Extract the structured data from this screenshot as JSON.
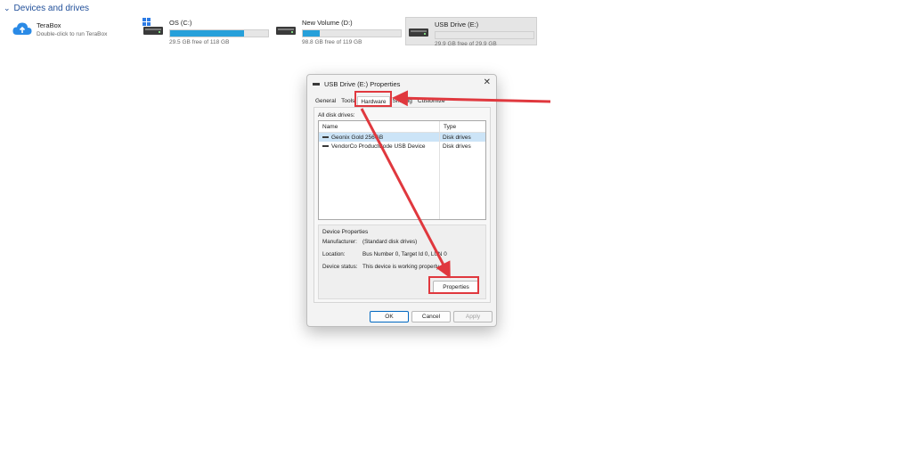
{
  "explorer": {
    "section_title": "Devices and drives",
    "terabox": {
      "name": "TeraBox",
      "subtitle": "Double-click to run TeraBox"
    },
    "drives": [
      {
        "name": "OS (C:)",
        "free_text": "29.5 GB free of 118 GB",
        "used_fraction": 0.75
      },
      {
        "name": "New Volume (D:)",
        "free_text": "98.8 GB free of 119 GB",
        "used_fraction": 0.17
      },
      {
        "name": "USB Drive (E:)",
        "free_text": "29.9 GB free of 29.9 GB",
        "used_fraction": 0.0
      }
    ]
  },
  "dialog": {
    "title": "USB Drive (E:) Properties",
    "close_glyph": "✕",
    "tabs": [
      "General",
      "Tools",
      "Hardware",
      "Sharing",
      "Customize"
    ],
    "active_tab": "Hardware",
    "all_disk_label": "All disk drives:",
    "columns": {
      "name": "Name",
      "type": "Type"
    },
    "rows": [
      {
        "name": "Geonix Gold 256GB",
        "type": "Disk drives"
      },
      {
        "name": "VendorCo ProductCode USB Device",
        "type": "Disk drives"
      }
    ],
    "device_properties": {
      "label": "Device Properties",
      "manufacturer_label": "Manufacturer:",
      "manufacturer_value": "(Standard disk drives)",
      "location_label": "Location:",
      "location_value": "Bus Number 0, Target Id 0, LUN 0",
      "status_label": "Device status:",
      "status_value": "This device is working properly."
    },
    "properties_button": "Properties",
    "ok_button": "OK",
    "cancel_button": "Cancel",
    "apply_button": "Apply"
  },
  "colors": {
    "accent": "#26a0da",
    "highlight": "#e0383e",
    "link": "#1f4e99"
  }
}
